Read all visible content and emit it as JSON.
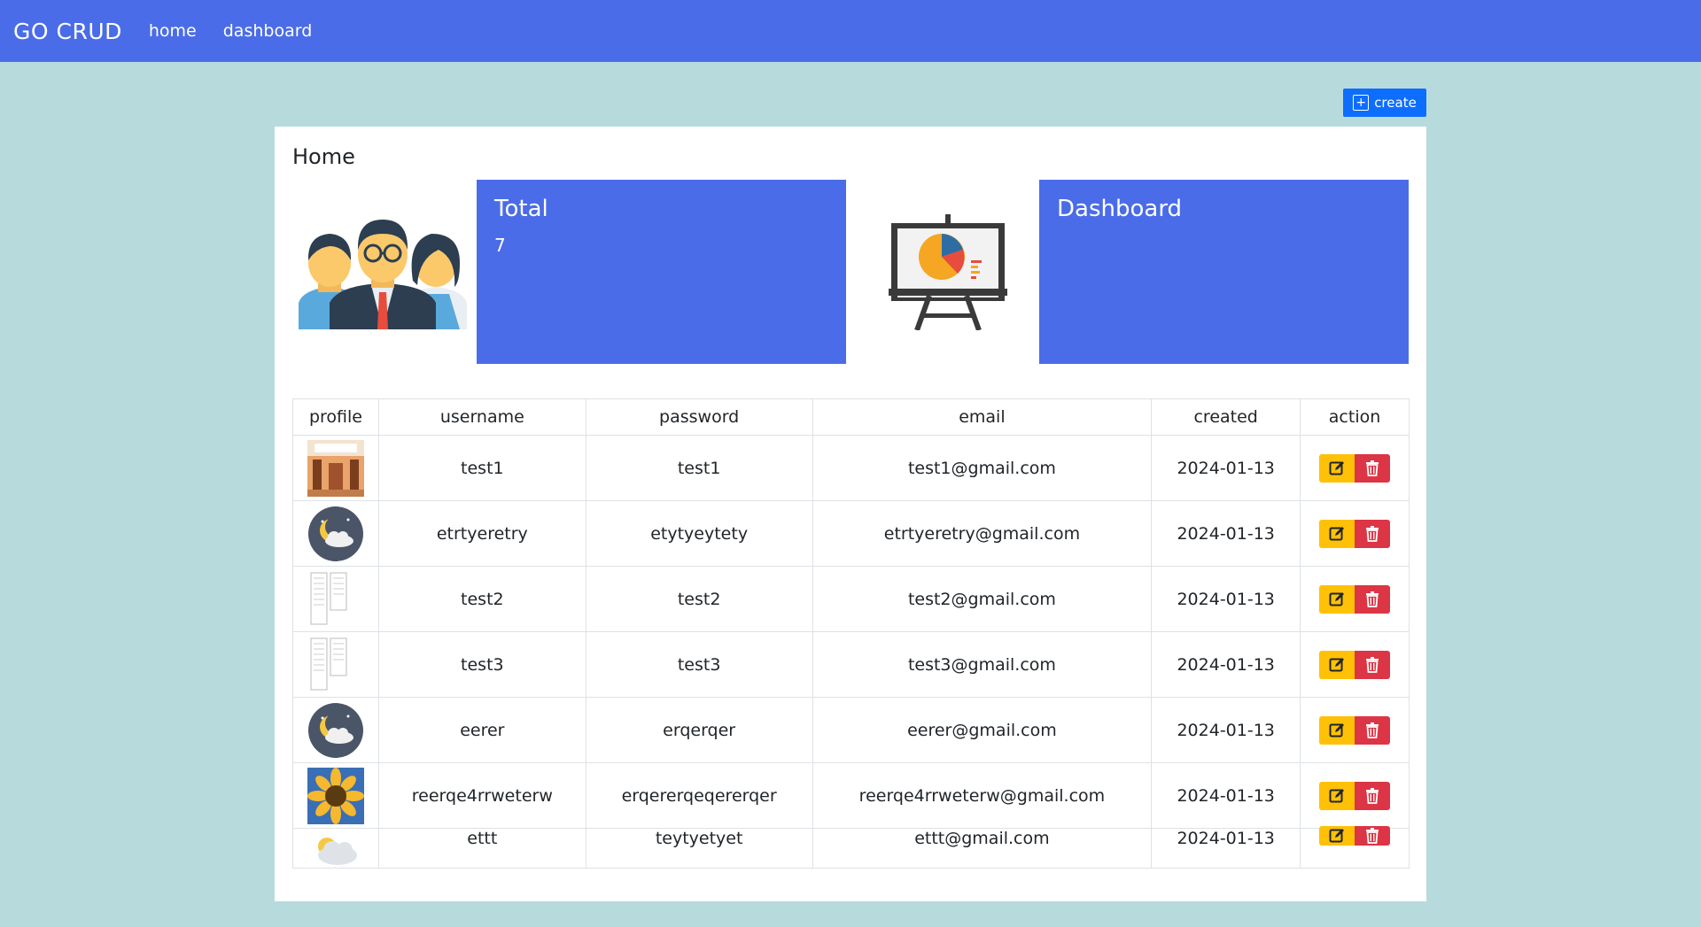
{
  "nav": {
    "brand": "GO CRUD",
    "links": [
      "home",
      "dashboard"
    ]
  },
  "create_label": "create",
  "page_title": "Home",
  "tiles": [
    {
      "title": "Total",
      "value": "7",
      "icon": "team-people-icon"
    },
    {
      "title": "Dashboard",
      "value": "",
      "icon": "presentation-chart-icon"
    }
  ],
  "table": {
    "headers": [
      "profile",
      "username",
      "password",
      "email",
      "created",
      "action"
    ],
    "rows": [
      {
        "avatar": "room-photo",
        "username": "test1",
        "password": "test1",
        "email": "test1@gmail.com",
        "created": "2024-01-13"
      },
      {
        "avatar": "moon-cloud-icon",
        "username": "etrtyeretry",
        "password": "etytyeytety",
        "email": "etrtyeretry@gmail.com",
        "created": "2024-01-13"
      },
      {
        "avatar": "document-thumbnail",
        "username": "test2",
        "password": "test2",
        "email": "test2@gmail.com",
        "created": "2024-01-13"
      },
      {
        "avatar": "document-thumbnail",
        "username": "test3",
        "password": "test3",
        "email": "test3@gmail.com",
        "created": "2024-01-13"
      },
      {
        "avatar": "moon-cloud-icon",
        "username": "eerer",
        "password": "erqerqer",
        "email": "eerer@gmail.com",
        "created": "2024-01-13"
      },
      {
        "avatar": "sunflower-photo",
        "username": "reerqe4rrweterw",
        "password": "erqererqeqererqer",
        "email": "reerqe4rrweterw@gmail.com",
        "created": "2024-01-13"
      },
      {
        "avatar": "sun-rain-cloud-icon",
        "username": "ettt",
        "password": "teytyetyet",
        "email": "ettt@gmail.com",
        "created": "2024-01-13"
      }
    ]
  },
  "colors": {
    "navbar": "#4a6ce8",
    "background": "#b7dbdd",
    "edit": "#ffc107",
    "delete": "#dc3545",
    "create": "#0d6efd"
  }
}
